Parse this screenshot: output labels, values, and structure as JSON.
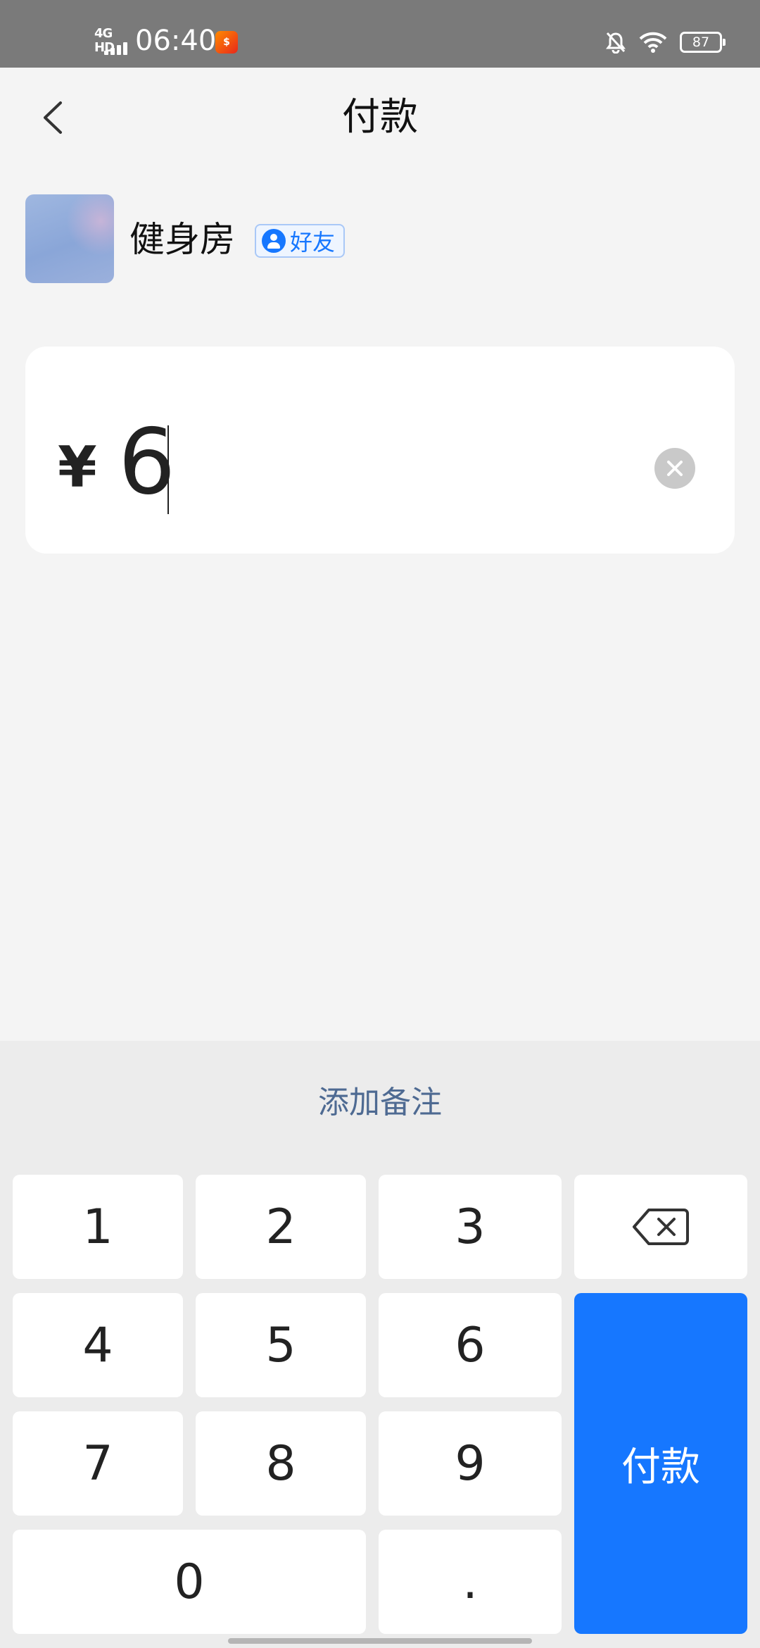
{
  "status_bar": {
    "network": "4G HD",
    "time": "06:40",
    "app_icon": "app-notification-icon",
    "battery": "87",
    "icons": [
      "bell-off-icon",
      "wifi-icon",
      "battery-icon"
    ]
  },
  "header": {
    "title": "付款",
    "back_icon": "chevron-left-icon"
  },
  "payee": {
    "name": "健身房",
    "badge": "好友",
    "badge_icon": "user-icon"
  },
  "amount": {
    "currency_symbol": "¥",
    "value": "6"
  },
  "keyboard": {
    "add_note": "添加备注",
    "keys": {
      "k1": "1",
      "k2": "2",
      "k3": "3",
      "k4": "4",
      "k5": "5",
      "k6": "6",
      "k7": "7",
      "k8": "8",
      "k9": "9",
      "k0": "0",
      "dot": "."
    },
    "backspace_icon": "backspace-icon",
    "pay_label": "付款"
  },
  "colors": {
    "accent": "#1677ff",
    "status_bar_bg": "#7a7a7a",
    "page_bg": "#f4f4f4",
    "keyboard_bg": "#ececec",
    "note_text": "#4e6a92"
  }
}
